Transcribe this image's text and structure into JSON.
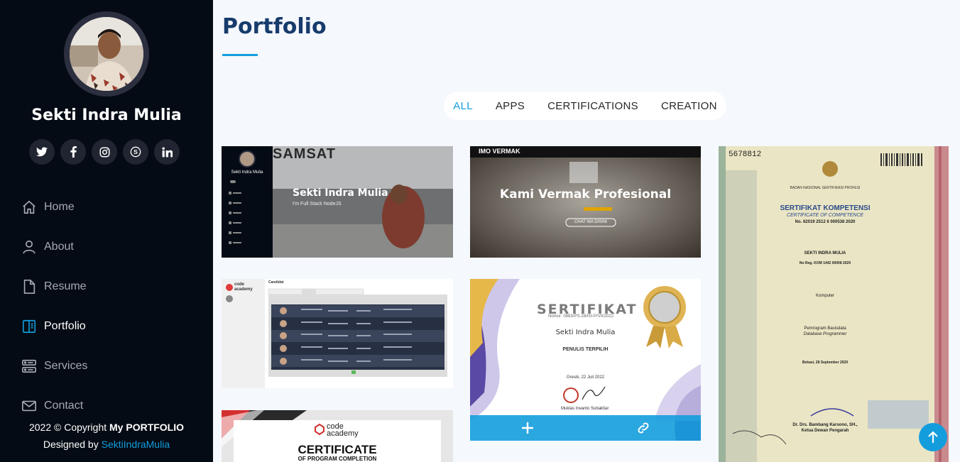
{
  "profile": {
    "name": "Sekti Indra Mulia"
  },
  "socials": [
    {
      "icon": "twitter-icon",
      "glyph": "t"
    },
    {
      "icon": "facebook-icon",
      "glyph": "f"
    },
    {
      "icon": "instagram-icon",
      "glyph": "◎"
    },
    {
      "icon": "skype-icon",
      "glyph": "S"
    },
    {
      "icon": "linkedin-icon",
      "glyph": "in"
    }
  ],
  "nav": {
    "home": "Home",
    "about": "About",
    "resume": "Resume",
    "portfolio": "Portfolio",
    "services": "Services",
    "contact": "Contact"
  },
  "footer": {
    "copyright_prefix": "2022 © Copyright ",
    "copyright_bold": "My PORTFOLIO",
    "designed_prefix": "Designed by ",
    "designed_link": "SektiIndraMulia"
  },
  "main": {
    "title": "Portfolio",
    "filters": [
      "ALL",
      "APPS",
      "CERTIFICATIONS",
      "CREATION"
    ]
  },
  "cards": {
    "c1": {
      "heading": "Sekti Indra Mulia",
      "sub": "I'm Full Stack NodeJS",
      "banner": "SAMSAT",
      "side_name": "Sekti Indra Mulia"
    },
    "c2": {
      "brand": "IMO VERMAK",
      "heading": "Kami Vermak Profesional",
      "button": "CHAT WA DISINI"
    },
    "c3": {
      "logo": "code academy",
      "page_title": "Candidat"
    },
    "c4": {
      "heading": "SERTIFIKAT",
      "nomor": "Nomor: 0883/PS-28/ISI-P/VII/2022",
      "name": "Sekti Indra Mulia",
      "role": "PENULIS TERPILIH",
      "place_date": "Gresik, 22 Juli 2022",
      "signer": "Muklas Irwanto Subaktiar"
    },
    "c5": {
      "serial": "5678812",
      "agency": "BADAN NASIONAL SERTIFIKASI PROFESI",
      "heading": "SERTIFIKAT KOMPETENSI",
      "heading_en": "CERTIFICATE OF COMPETENCE",
      "number": "No. 62019 2512 6 000538 2020",
      "name": "SEKTI INDRA MULIA",
      "reg": "No Reg. KOM 1442 00008 2020",
      "field": "Komputer",
      "qual": "Pemrogram Basisdata",
      "qual_en": "Database Programmer",
      "place_date": "Bekasi, 28 September 2020",
      "signer": "Dr. Drs. Bambang Karsono, SH.,",
      "signer_title": "Ketua Dewan Pengarah"
    },
    "c6": {
      "logo": "code academy",
      "heading": "CERTIFICATE",
      "sub": "OF PROGRAM COMPLETION"
    }
  }
}
